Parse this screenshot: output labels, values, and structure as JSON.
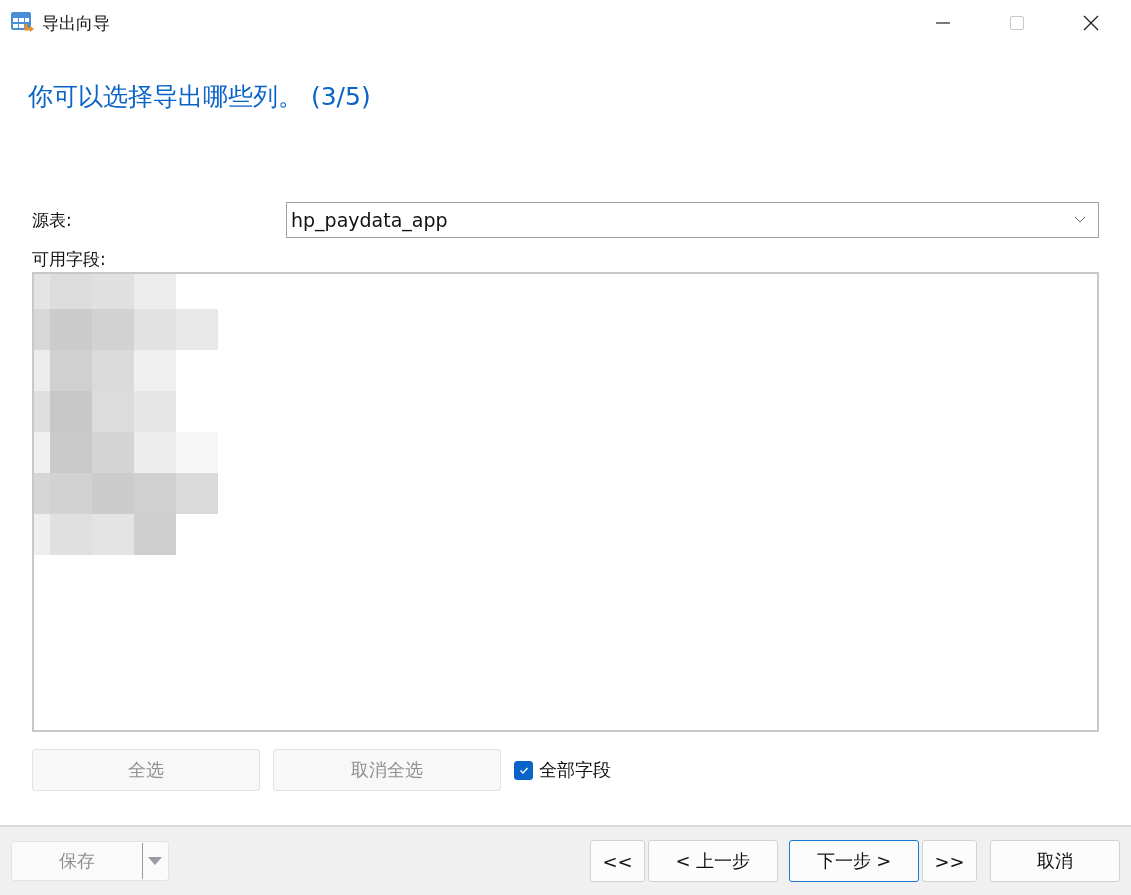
{
  "window": {
    "title": "导出向导"
  },
  "heading": "你可以选择导出哪些列。 (3/5)",
  "source": {
    "label": "源表:",
    "value": "hp_paydata_app"
  },
  "fields": {
    "label": "可用字段:",
    "redacted": true
  },
  "select_buttons": [
    {
      "label": "全选",
      "disabled": true
    },
    {
      "label": "取消全选",
      "disabled": true
    }
  ],
  "all_fields": {
    "label": "全部字段",
    "checked": true
  },
  "save": {
    "label": "保存",
    "disabled": true
  },
  "nav_buttons": [
    {
      "label": "<<",
      "default": false
    },
    {
      "label": "< 上一步",
      "default": false
    },
    {
      "label": "下一步 >",
      "default": true
    },
    {
      "label": ">>",
      "default": false
    }
  ],
  "cancel": {
    "label": "取消"
  }
}
